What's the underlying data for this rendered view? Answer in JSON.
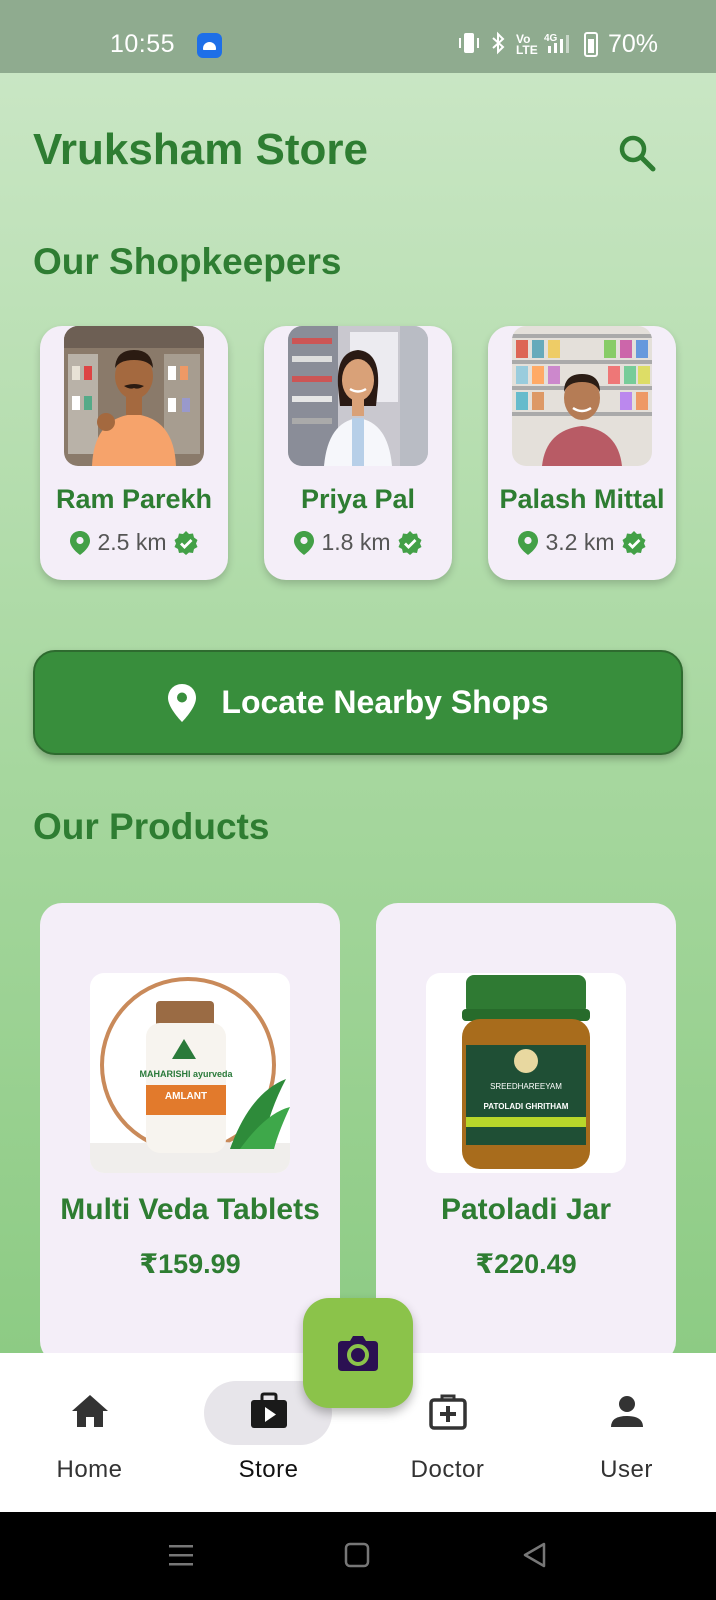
{
  "status_bar": {
    "time": "10:55",
    "lte_label": "Vo\nLTE",
    "network_label": "4G",
    "battery": "70%"
  },
  "header": {
    "title": "Vruksham Store",
    "search_icon": "search-icon"
  },
  "shopkeepers": {
    "title": "Our Shopkeepers",
    "items": [
      {
        "name": "Ram Parekh",
        "distance": "2.5 km",
        "verified": true
      },
      {
        "name": "Priya Pal",
        "distance": "1.8 km",
        "verified": true
      },
      {
        "name": "Palash Mittal",
        "distance": "3.2 km",
        "verified": true
      }
    ]
  },
  "locate_button": {
    "label": "Locate Nearby Shops",
    "icon": "location-pin-icon"
  },
  "products": {
    "title": "Our Products",
    "items": [
      {
        "name": "Multi Veda Tablets",
        "price": "₹159.99",
        "brand_text": "MAHARISHI ayurveda",
        "product_text": "AMLANT"
      },
      {
        "name": "Patoladi Jar",
        "price": "₹220.49",
        "brand_text": "SREEDHAREEYAM",
        "product_text": "PATOLADI GHRITHAM"
      }
    ]
  },
  "bottom_nav": {
    "active": "Store",
    "items": [
      {
        "label": "Home",
        "icon": "home-icon"
      },
      {
        "label": "Store",
        "icon": "store-icon"
      },
      {
        "label": "Doctor",
        "icon": "medical-kit-icon"
      },
      {
        "label": "User",
        "icon": "user-icon"
      }
    ]
  },
  "colors": {
    "primary_green": "#2e7d32",
    "button_green": "#388e3c",
    "fab_green": "#8bc34a",
    "card_background": "#f4eef8",
    "verified_green": "#43a047"
  }
}
